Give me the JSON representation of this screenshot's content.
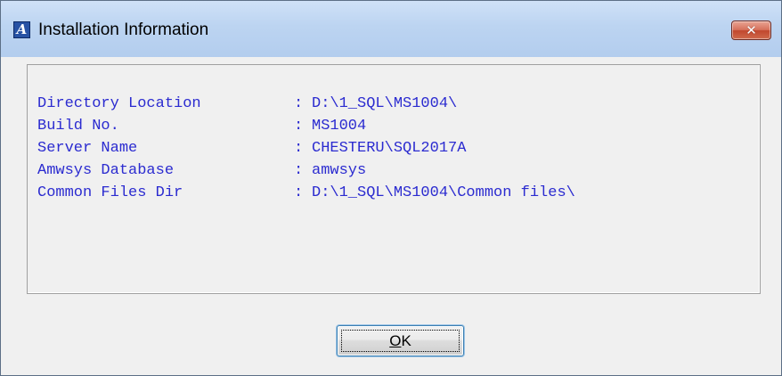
{
  "window": {
    "title": "Installation Information",
    "app_icon_letter": "A",
    "close_symbol": "✕"
  },
  "info": {
    "separator": ":",
    "rows": [
      {
        "label": "Directory Location",
        "value": "D:\\1_SQL\\MS1004\\"
      },
      {
        "label": "Build No.",
        "value": "MS1004"
      },
      {
        "label": "Server Name",
        "value": "CHESTERU\\SQL2017A"
      },
      {
        "label": "Amwsys Database",
        "value": "amwsys"
      },
      {
        "label": "Common Files Dir",
        "value": "D:\\1_SQL\\MS1004\\Common files\\"
      }
    ]
  },
  "buttons": {
    "ok_mnemonic": "O",
    "ok_rest": "K"
  },
  "colors": {
    "info_text": "#2b2bd0",
    "title_bar": "#bcd4f1",
    "close_button": "#c1472e"
  }
}
